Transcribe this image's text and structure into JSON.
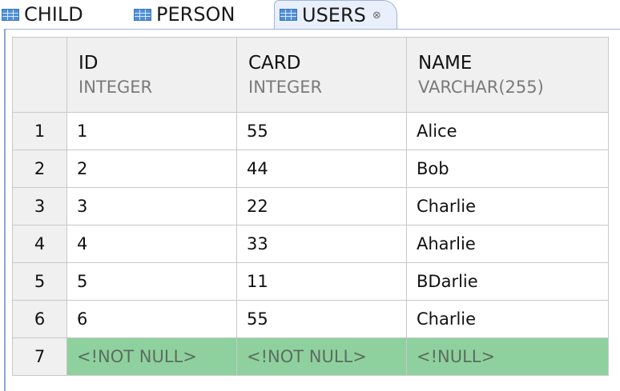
{
  "tabs": [
    {
      "label": "CHILD"
    },
    {
      "label": "PERSON"
    },
    {
      "label": "USERS",
      "close": "⊗"
    }
  ],
  "columns": [
    {
      "name": "ID",
      "type": "INTEGER"
    },
    {
      "name": "CARD",
      "type": "INTEGER"
    },
    {
      "name": "NAME",
      "type": "VARCHAR(255)"
    }
  ],
  "rows": [
    {
      "num": "1",
      "id": "1",
      "card": "55",
      "name": "Alice"
    },
    {
      "num": "2",
      "id": "2",
      "card": "44",
      "name": "Bob"
    },
    {
      "num": "3",
      "id": "3",
      "card": "22",
      "name": "Charlie"
    },
    {
      "num": "4",
      "id": "4",
      "card": "33",
      "name": "Aharlie"
    },
    {
      "num": "5",
      "id": "5",
      "card": "11",
      "name": "BDarlie"
    },
    {
      "num": "6",
      "id": "6",
      "card": "55",
      "name": "Charlie"
    }
  ],
  "new_row": {
    "num": "7",
    "id": "<!NOT NULL>",
    "card": "<!NOT NULL>",
    "name": "<!NULL>"
  },
  "colors": {
    "new_row_bg": "#8fd19e",
    "header_bg": "#f0f0f0",
    "tab_icon": "#4e8fd8"
  }
}
